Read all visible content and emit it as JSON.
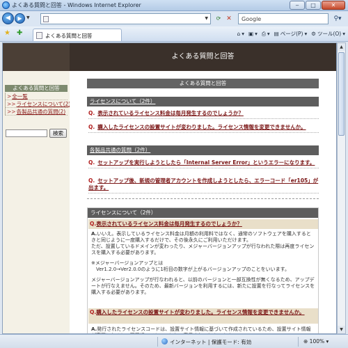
{
  "window": {
    "title": "よくある質問と回答 - Windows Internet Explorer",
    "min_glyph": "‒",
    "max_glyph": "□",
    "close_glyph": "✕"
  },
  "addressbar": {
    "url": "",
    "search_placeholder": "Google"
  },
  "tab": {
    "label": "よくある質問と回答"
  },
  "toolbar": {
    "page_label": "ページ(P)",
    "tools_label": "ツール(O)"
  },
  "page": {
    "header_title": "よくある質問と回答",
    "sidebar": {
      "heading": "よくある質問と回答",
      "items": [
        {
          "arrow": ">",
          "label": "全一覧"
        },
        {
          "arrow": ">>",
          "label": "ライセンスについて(2)"
        },
        {
          "arrow": ">>",
          "label": "各製品共通の質問(2)"
        }
      ],
      "search_button": "検索"
    },
    "main": {
      "bar_title": "よくある質問と回答",
      "sections": [
        {
          "title": "ライセンスについて（2件）",
          "questions": [
            "表示されているライセンス料金は毎月発生するのでしょうか？",
            "購入したライセンスの設置サイトが変わりました。ライセンス情報を変更できませんか。"
          ]
        },
        {
          "title": "各製品共通の質問（2件）",
          "questions": [
            "セットアップを実行しようとしたら「Internal Server Error」というエラーになります。",
            "セットアップ後、新規の管理者アカウントを作成しようとしたら、エラーコード「er105」が出ます。"
          ]
        }
      ],
      "q_mark": "Q.",
      "detail": {
        "section_title": "ライセンスについて（2件）",
        "items": [
          {
            "question": "表示されているライセンス料金は毎月発生するのでしょうか？",
            "answer_mark": "A.",
            "answer": [
              "いいえ。表示しているライセンス料金は月額の利用料ではなく、通常のソフトウェアを購入するときと同じように一度購入するだけで、その後永久にご利用いただけます。",
              "ただ、設置しているドメインが変わったり、メジャーバージョンアップが行なわれた際は再度ライセンスを購入する必要があります。",
              "",
              "※メジャーバージョンアップとは",
              "　Ver1.2.0→Ver2.0.0のように1桁目の数字が上がるバージョンアップのことをいいます。",
              "",
              "メジャーバージョンアップが行なわれると、以前のバージョンと一部互換性が無くなるため、アップデートが行なえません。そのため、最新バージョンを利用するには、新たに設置を行なってライセンスを購入する必要があります。"
            ]
          },
          {
            "question": "購入したライセンスの設置サイトが変わりました。ライセンス情報を変更できませんか。",
            "answer_mark": "A.",
            "answer": [
              "発行されたライセンスコードは、設置サイト情報に基づいて作成されているため、設置サイト情報が変更になると、不正規ライセンスとして表示されてしまいます。"
            ]
          }
        ]
      }
    }
  },
  "statusbar": {
    "zone": "インターネット | 保護モード: 有効",
    "zoom": "100%"
  }
}
